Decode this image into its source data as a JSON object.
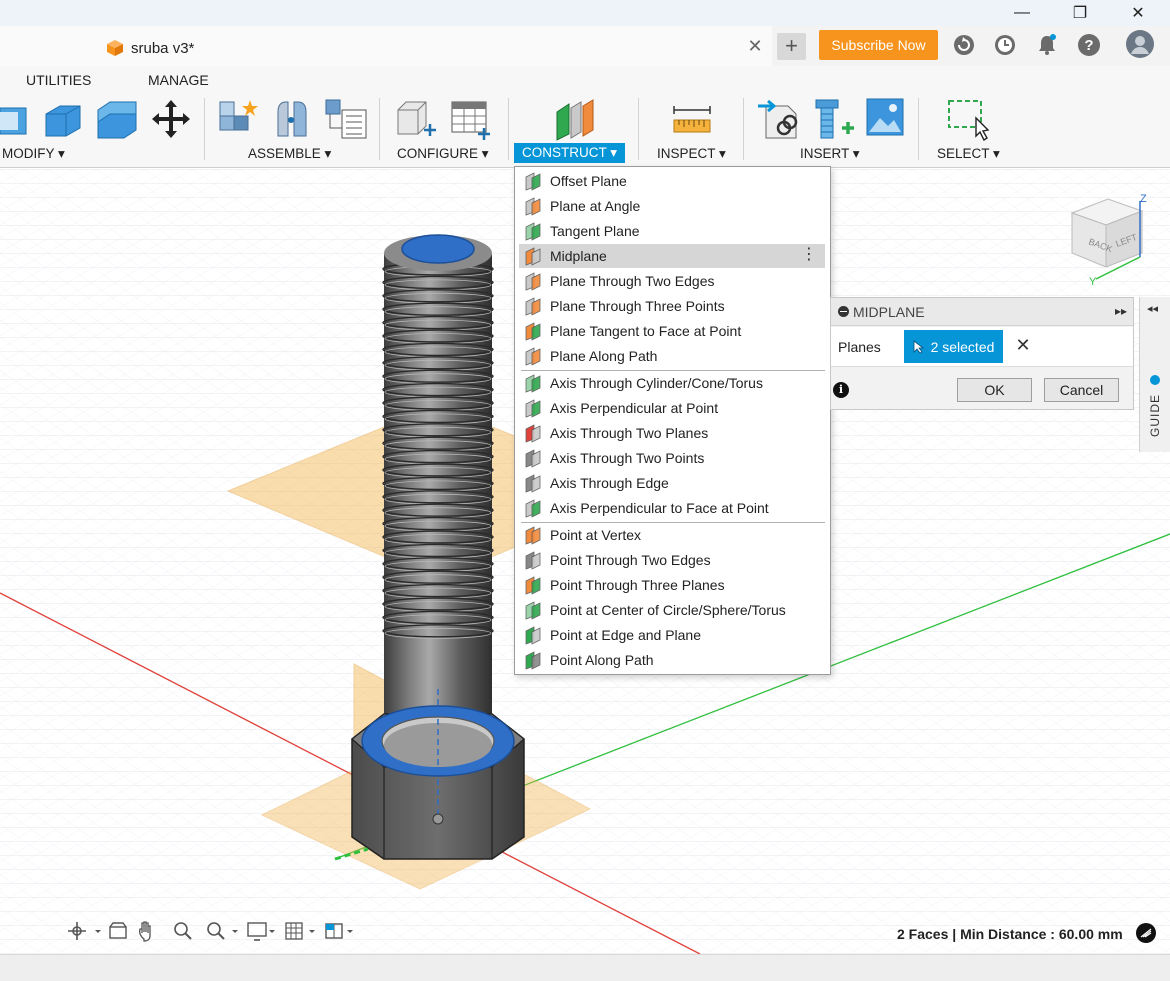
{
  "window": {
    "minimize": "—",
    "maximize": "❐",
    "close": "✕"
  },
  "document": {
    "title": "sruba v3*",
    "close": "✕",
    "new_tab": "+"
  },
  "header": {
    "subscribe": "Subscribe Now"
  },
  "workspace_tabs": [
    "UTILITIES",
    "MANAGE"
  ],
  "toolbar": {
    "groups": [
      {
        "label": "MODIFY ▾"
      },
      {
        "label": "ASSEMBLE ▾"
      },
      {
        "label": "CONFIGURE ▾"
      },
      {
        "label": "CONSTRUCT ▾"
      },
      {
        "label": "INSPECT ▾"
      },
      {
        "label": "INSERT ▾"
      },
      {
        "label": "SELECT ▾"
      }
    ]
  },
  "construct_menu": {
    "items": [
      {
        "label": "Offset Plane",
        "icon": "offset-plane-icon"
      },
      {
        "label": "Plane at Angle",
        "icon": "plane-at-angle-icon"
      },
      {
        "label": "Tangent Plane",
        "icon": "tangent-plane-icon"
      },
      {
        "label": "Midplane",
        "icon": "midplane-icon"
      },
      {
        "label": "Plane Through Two Edges",
        "icon": "plane-two-edges-icon"
      },
      {
        "label": "Plane Through Three Points",
        "icon": "plane-three-points-icon"
      },
      {
        "label": "Plane Tangent to Face at Point",
        "icon": "plane-tangent-face-icon"
      },
      {
        "label": "Plane Along Path",
        "icon": "plane-along-path-icon"
      },
      {
        "label": "Axis Through Cylinder/Cone/Torus",
        "icon": "axis-cylinder-icon"
      },
      {
        "label": "Axis Perpendicular at Point",
        "icon": "axis-perpendicular-point-icon"
      },
      {
        "label": "Axis Through Two Planes",
        "icon": "axis-two-planes-icon"
      },
      {
        "label": "Axis Through Two Points",
        "icon": "axis-two-points-icon"
      },
      {
        "label": "Axis Through Edge",
        "icon": "axis-edge-icon"
      },
      {
        "label": "Axis Perpendicular to Face at Point",
        "icon": "axis-perpendicular-face-icon"
      },
      {
        "label": "Point at Vertex",
        "icon": "point-vertex-icon"
      },
      {
        "label": "Point Through Two Edges",
        "icon": "point-two-edges-icon"
      },
      {
        "label": "Point Through Three Planes",
        "icon": "point-three-planes-icon"
      },
      {
        "label": "Point at Center of Circle/Sphere/Torus",
        "icon": "point-center-icon"
      },
      {
        "label": "Point at Edge and Plane",
        "icon": "point-edge-plane-icon"
      },
      {
        "label": "Point Along Path",
        "icon": "point-along-path-icon"
      }
    ],
    "highlighted": "Midplane",
    "more_options": "⋮"
  },
  "midplane_dialog": {
    "title": "MIDPLANE",
    "expand": "▸▸",
    "planes_label": "Planes",
    "selection": "2 selected",
    "clear": "✕",
    "info": "i",
    "ok": "OK",
    "cancel": "Cancel"
  },
  "guide": {
    "label": "GUIDE",
    "collapse": "◂◂"
  },
  "view_cube": {
    "faces": [
      "BACK",
      "LEFT"
    ],
    "axes": [
      "Z",
      "Y"
    ]
  },
  "status": {
    "text": "2 Faces | Min Distance : 60.00 mm"
  },
  "colors": {
    "accent": "#0696d7",
    "subscribe": "#f7941d",
    "plane_fill": "#f5b44a",
    "selected_face": "#2f6fc8",
    "x_axis": "#e0413a",
    "y_axis": "#2fbf3f"
  }
}
